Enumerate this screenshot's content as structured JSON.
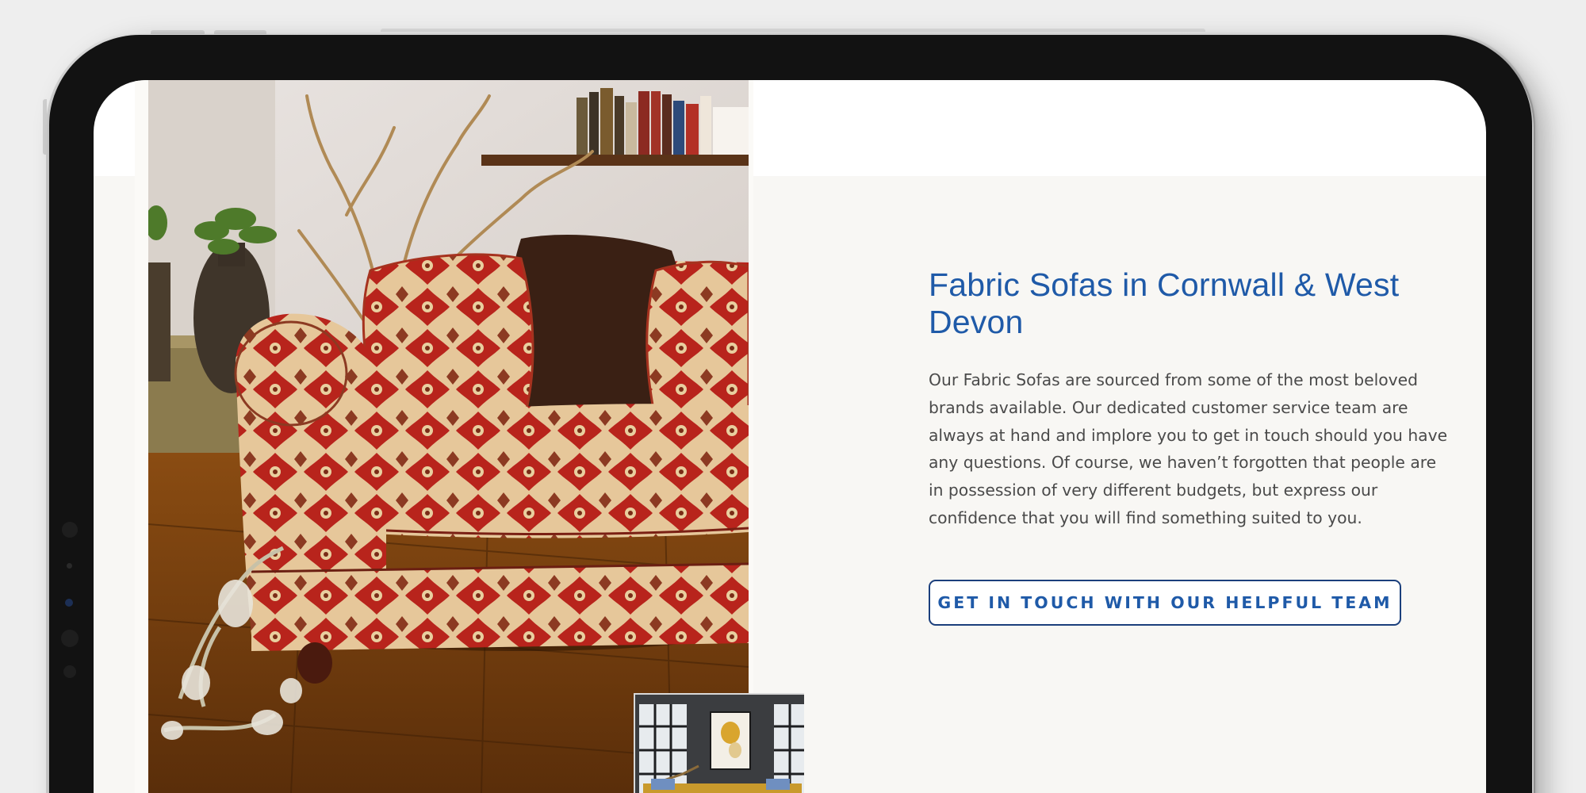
{
  "section": {
    "heading": "Fabric Sofas in Cornwall & West Devon",
    "body": "Our Fabric Sofas are sourced from some of the most beloved brands available. Our dedicated customer service team are always at hand and implore you to get in touch should you have any questions. Of course, we haven’t forgotten that people are in possession of very different budgets, but express our confidence that you will find something suited to you.",
    "cta_label": "GET IN TOUCH WITH OUR HELPFUL TEAM"
  },
  "colors": {
    "heading": "#1f5aa8",
    "body_text": "#4a4a4a",
    "cta_border": "#1b3f7c",
    "section_background": "#f8f7f4",
    "device_bezel": "#121212"
  },
  "images": {
    "main_photo": "red-damask-fabric-sofa-room-photo",
    "thumbnail": "mustard-sofa-dark-room-photo"
  }
}
